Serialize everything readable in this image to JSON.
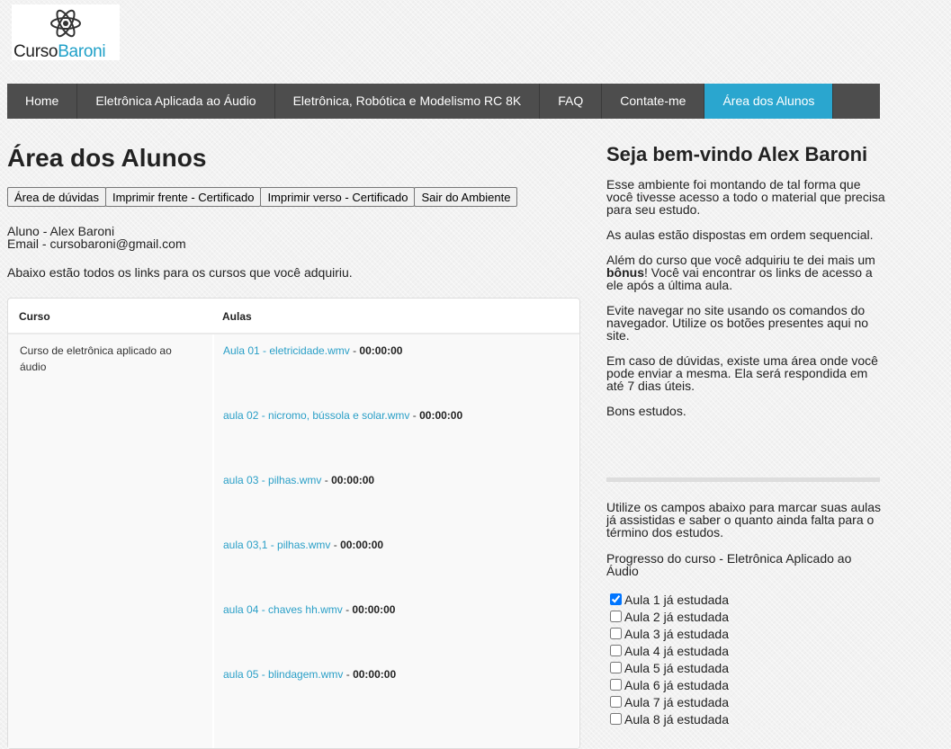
{
  "logo": {
    "part1": "Curso",
    "part2": "Baroni"
  },
  "nav": [
    {
      "label": "Home",
      "active": false
    },
    {
      "label": "Eletrônica Aplicada ao Áudio",
      "active": false
    },
    {
      "label": "Eletrônica, Robótica e Modelismo RC 8K",
      "active": false
    },
    {
      "label": "FAQ",
      "active": false
    },
    {
      "label": "Contate-me",
      "active": false
    },
    {
      "label": "Área dos Alunos",
      "active": true
    }
  ],
  "main": {
    "title": "Área dos Alunos",
    "buttons": [
      "Área de dúvidas",
      "Imprimir frente - Certificado",
      "Imprimir verso - Certificado",
      "Sair do Ambiente"
    ],
    "student_line": "Aluno - Alex Baroni",
    "email_line": "Email - cursobaroni@gmail.com",
    "intro": "Abaixo estão todos os links para os cursos que você adquiriu.",
    "table": {
      "headers": [
        "Curso",
        "Aulas"
      ],
      "course": "Curso de eletrônica aplicado ao áudio",
      "lessons": [
        {
          "link": "Aula 01 - eletricidade.wmv",
          "duration": "00:00:00"
        },
        {
          "link": "aula 02 - nicromo, bússola e solar.wmv",
          "duration": "00:00:00"
        },
        {
          "link": "aula 03 - pilhas.wmv",
          "duration": "00:00:00"
        },
        {
          "link": "aula 03,1 - pilhas.wmv",
          "duration": "00:00:00"
        },
        {
          "link": "aula 04 - chaves hh.wmv",
          "duration": "00:00:00"
        },
        {
          "link": "aula 05 - blindagem.wmv",
          "duration": "00:00:00"
        }
      ]
    }
  },
  "sidebar": {
    "welcome": "Seja bem-vindo Alex Baroni",
    "p1": "Esse ambiente foi montando de tal forma que você tivesse acesso a todo o material que precisa para seu estudo.",
    "p2": "As aulas estão dispostas em ordem sequencial.",
    "p3_before": "Além do curso que você adquiriu te dei mais um ",
    "p3_bold": "bônus",
    "p3_after": "! Você vai encontrar os links de acesso a ele após a última aula.",
    "p4": "Evite navegar no site usando os comandos do navegador. Utilize os botões presentes aqui no site.",
    "p5": "Em caso de dúvidas, existe uma área onde você pode enviar a mesma. Ela será respondida em até 7 dias úteis.",
    "p6": "Bons estudos.",
    "progress_intro": "Utilize os campos abaixo para marcar suas aulas já assistidas e saber o quanto ainda falta para o término dos estudos.",
    "progress_title": "Progresso do curso - Eletrônica Aplicado ao Áudio",
    "checkboxes": [
      {
        "label": "Aula 1 já estudada",
        "checked": true
      },
      {
        "label": "Aula 2 já estudada",
        "checked": false
      },
      {
        "label": "Aula 3 já estudada",
        "checked": false
      },
      {
        "label": "Aula 4 já estudada",
        "checked": false
      },
      {
        "label": "Aula 5 já estudada",
        "checked": false
      },
      {
        "label": "Aula 6 já estudada",
        "checked": false
      },
      {
        "label": "Aula 7 já estudada",
        "checked": false
      },
      {
        "label": "Aula 8 já estudada",
        "checked": false
      }
    ]
  },
  "colors": {
    "accent": "#2aa6cf",
    "nav_bg": "#4d4d4d",
    "link": "#2a9fc7"
  }
}
